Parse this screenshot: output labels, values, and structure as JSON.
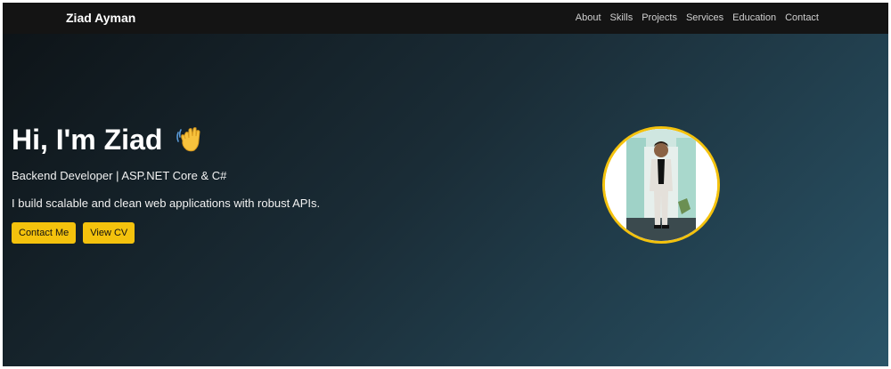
{
  "navbar": {
    "brand": "Ziad Ayman",
    "links": [
      "About",
      "Skills",
      "Projects",
      "Services",
      "Education",
      "Contact"
    ]
  },
  "hero": {
    "title": "Hi, I'm Ziad",
    "title_icon": "waving-hand-icon",
    "subtitle": "Backend Developer | ASP.NET Core & C#",
    "description": "I build scalable and clean web applications with robust APIs.",
    "buttons": {
      "contact": "Contact Me",
      "cv": "View CV"
    },
    "avatar": "profile-photo"
  },
  "colors": {
    "accent": "#f4c20d",
    "navbar_bg": "#141414",
    "hero_gradient_start": "#0e1418",
    "hero_gradient_end": "#2a5468"
  }
}
